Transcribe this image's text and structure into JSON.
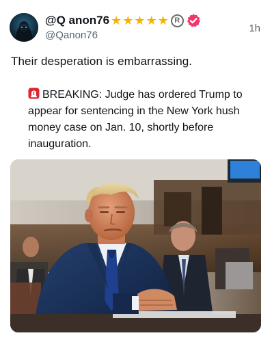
{
  "author": {
    "display_name": "@Q anon76",
    "star_glyph": "★",
    "star_count": 5,
    "registered_mark": "R",
    "handle": "@Qanon76",
    "avatar_icon": "hooded-figure-avatar",
    "verified_icon": "verified-badge-icon",
    "verified_color": "#f0386b"
  },
  "timestamp": "1h",
  "post_text": "Their desperation is embarrassing.",
  "quote": {
    "icon": "police-light-emoji",
    "lines": [
      "BREAKING: Judge has ordered Trump to",
      "appear for sentencing in the New York hush",
      "money case on Jan. 10, shortly before",
      "inauguration."
    ]
  },
  "media": {
    "type": "photo",
    "subject": "courtroom-photo"
  },
  "colors": {
    "text": "#0f1419",
    "secondary": "#536471",
    "star": "#f5b301"
  }
}
